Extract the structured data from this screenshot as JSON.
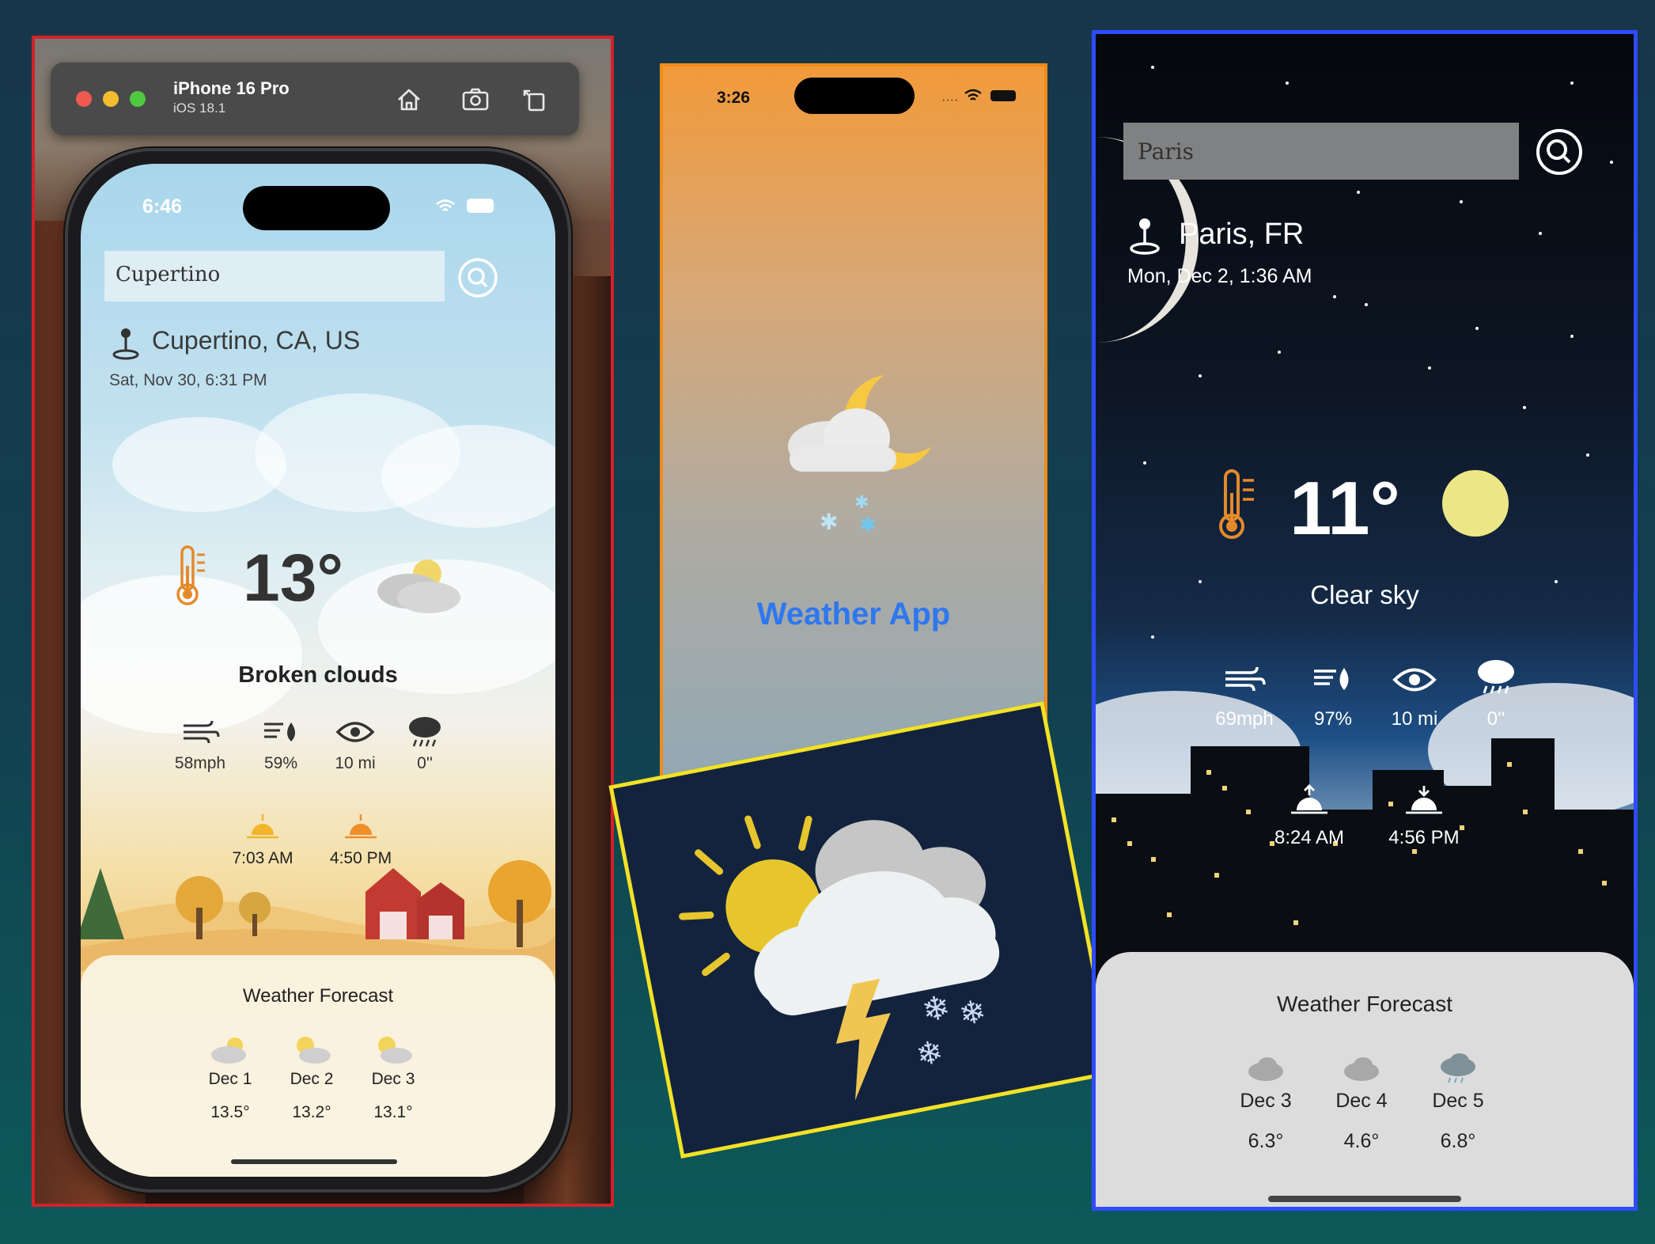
{
  "simulator": {
    "device_name": "iPhone 16 Pro",
    "os_version": "iOS 18.1"
  },
  "left_phone": {
    "status_time": "6:46",
    "search_value": "Cupertino",
    "location": "Cupertino, CA, US",
    "datetime": "Sat, Nov 30, 6:31 PM",
    "temperature": "13°",
    "condition": "Broken clouds",
    "metrics": [
      {
        "icon": "wind-icon",
        "value": "58mph"
      },
      {
        "icon": "humidity-icon",
        "value": "59%"
      },
      {
        "icon": "eye-icon",
        "value": "10 mi"
      },
      {
        "icon": "rain-cloud-icon",
        "value": "0''"
      }
    ],
    "sunrise": "7:03 AM",
    "sunset": "4:50 PM",
    "forecast_title": "Weather Forecast",
    "forecast": [
      {
        "day": "Dec 1",
        "temp": "13.5°"
      },
      {
        "day": "Dec 2",
        "temp": "13.2°"
      },
      {
        "day": "Dec 3",
        "temp": "13.1°"
      }
    ]
  },
  "center_phone": {
    "status_time": "3:26",
    "app_title": "Weather App"
  },
  "right_phone": {
    "search_value": "Paris",
    "location": "Paris, FR",
    "datetime": "Mon, Dec 2, 1:36 AM",
    "temperature": "11°",
    "condition": "Clear sky",
    "metrics": [
      {
        "icon": "wind-icon",
        "value": "69mph"
      },
      {
        "icon": "humidity-icon",
        "value": "97%"
      },
      {
        "icon": "eye-icon",
        "value": "10 mi"
      },
      {
        "icon": "rain-cloud-icon",
        "value": "0''"
      }
    ],
    "sunrise": "8:24 AM",
    "sunset": "4:56 PM",
    "forecast_title": "Weather Forecast",
    "forecast": [
      {
        "day": "Dec 3",
        "temp": "6.3°"
      },
      {
        "day": "Dec 4",
        "temp": "4.6°"
      },
      {
        "day": "Dec 5",
        "temp": "6.8°"
      }
    ]
  },
  "colors": {
    "left_border": "#d4202a",
    "center_border": "#f08c1a",
    "tile_border": "#f2e226",
    "right_border": "#2f4bff",
    "app_title": "#2e77f0",
    "thermometer": "#e58a2b"
  }
}
